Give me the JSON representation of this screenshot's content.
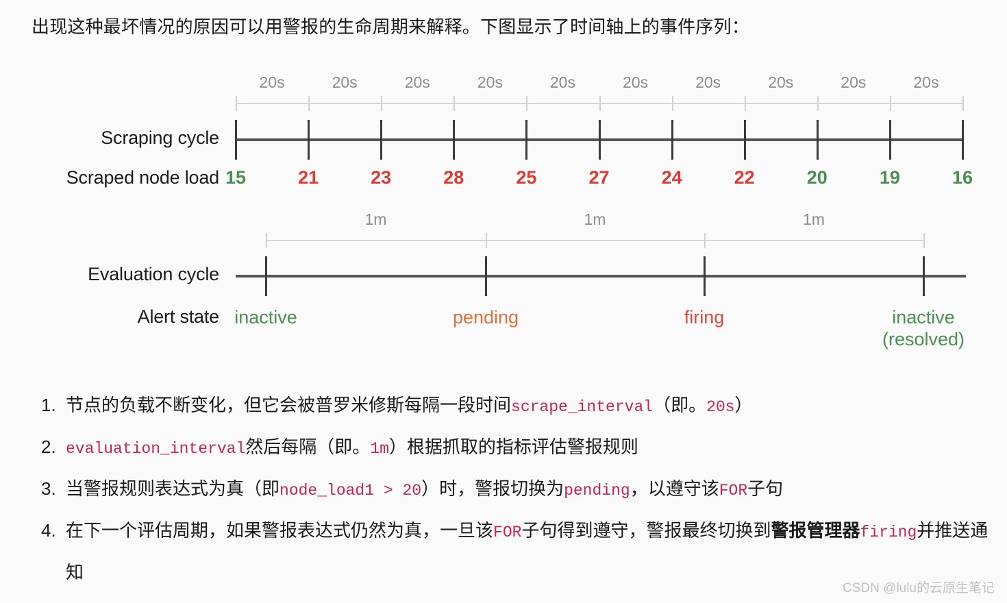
{
  "intro": {
    "text": "出现这种最坏情况的原因可以用警报的生命周期来解释。下图显示了时间轴上的事件序列："
  },
  "diagram": {
    "rows": {
      "scraping_cycle_label": "Scraping cycle",
      "scraped_node_load_label": "Scraped node load",
      "evaluation_cycle_label": "Evaluation cycle",
      "alert_state_label": "Alert state"
    },
    "scrape_interval_captions": [
      "20s",
      "20s",
      "20s",
      "20s",
      "20s",
      "20s",
      "20s",
      "20s",
      "20s",
      "20s"
    ],
    "scraped_loads": [
      {
        "value": "15",
        "color": "green"
      },
      {
        "value": "21",
        "color": "red"
      },
      {
        "value": "23",
        "color": "red"
      },
      {
        "value": "28",
        "color": "red"
      },
      {
        "value": "25",
        "color": "red"
      },
      {
        "value": "27",
        "color": "red"
      },
      {
        "value": "24",
        "color": "red"
      },
      {
        "value": "22",
        "color": "red"
      },
      {
        "value": "20",
        "color": "green"
      },
      {
        "value": "19",
        "color": "green"
      },
      {
        "value": "16",
        "color": "green"
      }
    ],
    "evaluation_interval_captions": [
      "1m",
      "1m",
      "1m"
    ],
    "alert_states": [
      {
        "line1": "inactive",
        "line2": "",
        "color": "green"
      },
      {
        "line1": "pending",
        "line2": "",
        "color": "orange"
      },
      {
        "line1": "firing",
        "line2": "",
        "color": "red"
      },
      {
        "line1": "inactive",
        "line2": "(resolved)",
        "color": "green"
      }
    ],
    "colors": {
      "green": "#4a9050",
      "red": "#e03a33",
      "orange": "#e2703a",
      "axis": "#555555",
      "ruler": "#d6d6d6",
      "caption": "#8d8d8d"
    }
  },
  "steps": [
    {
      "number": "1.",
      "parts": [
        {
          "t": "节点的负载不断变化，但它会被普罗米修斯每隔一段时间",
          "m": false
        },
        {
          "t": "scrape_interval",
          "m": true
        },
        {
          "t": "（即。",
          "m": false
        },
        {
          "t": "20s",
          "m": true
        },
        {
          "t": "）",
          "m": false
        }
      ]
    },
    {
      "number": "2.",
      "parts": [
        {
          "t": "evaluation_interval",
          "m": true
        },
        {
          "t": "然后每隔（即。",
          "m": false
        },
        {
          "t": "1m",
          "m": true
        },
        {
          "t": "）根据抓取的指标评估警报规则",
          "m": false
        }
      ]
    },
    {
      "number": "3.",
      "parts": [
        {
          "t": "当警报规则表达式为真（即",
          "m": false
        },
        {
          "t": "node_load1 > 20",
          "m": true
        },
        {
          "t": "）时，警报切换为",
          "m": false
        },
        {
          "t": "pending",
          "m": true
        },
        {
          "t": "，以遵守该",
          "m": false
        },
        {
          "t": "FOR",
          "m": true
        },
        {
          "t": "子句",
          "m": false
        }
      ]
    },
    {
      "number": "4.",
      "parts": [
        {
          "t": "在下一个评估周期，如果警报表达式仍然为真，一旦该",
          "m": false
        },
        {
          "t": "FOR",
          "m": true
        },
        {
          "t": "子句得到遵守，警报最终切换到",
          "m": false
        },
        {
          "t": "警报管理器",
          "m": false,
          "b": true
        },
        {
          "t": "firing",
          "m": true
        },
        {
          "t": "并推送通知",
          "m": false
        }
      ]
    }
  ],
  "watermark": {
    "text": "CSDN @lulu的云原生笔记"
  }
}
